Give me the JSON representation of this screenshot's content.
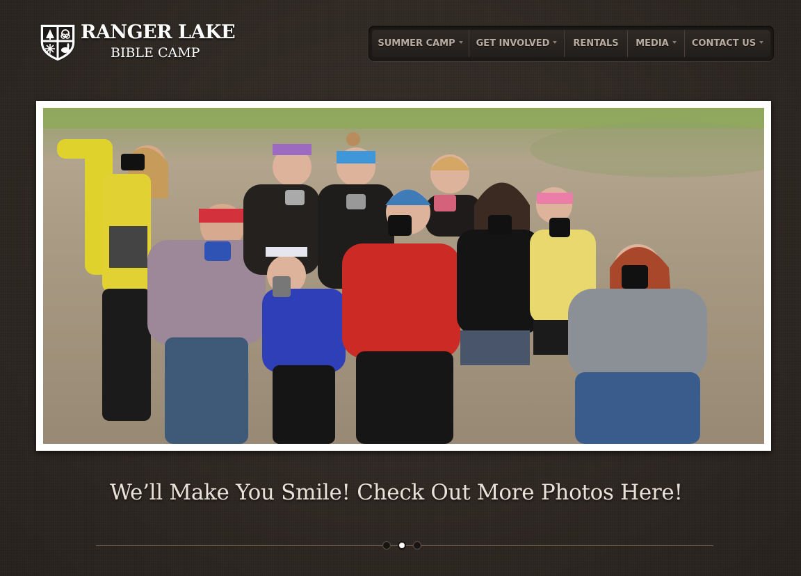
{
  "logo": {
    "title": "RANGER LAKE",
    "subtitle": "BIBLE CAMP"
  },
  "nav": {
    "items": [
      {
        "label": "SUMMER CAMP",
        "has_dropdown": true
      },
      {
        "label": "GET INVOLVED",
        "has_dropdown": true
      },
      {
        "label": "RENTALS",
        "has_dropdown": false
      },
      {
        "label": "MEDIA",
        "has_dropdown": true
      },
      {
        "label": "CONTACT US",
        "has_dropdown": true
      }
    ]
  },
  "slider": {
    "caption": "We’ll Make You Smile! Check Out More Photos Here!",
    "slide_count": 3,
    "active_slide": 2
  },
  "colors": {
    "background": "#2e2823",
    "nav_text": "#b9ada2",
    "caption_text": "#e8e1d8",
    "frame": "#ffffff",
    "pager_line": "#7d6654"
  }
}
